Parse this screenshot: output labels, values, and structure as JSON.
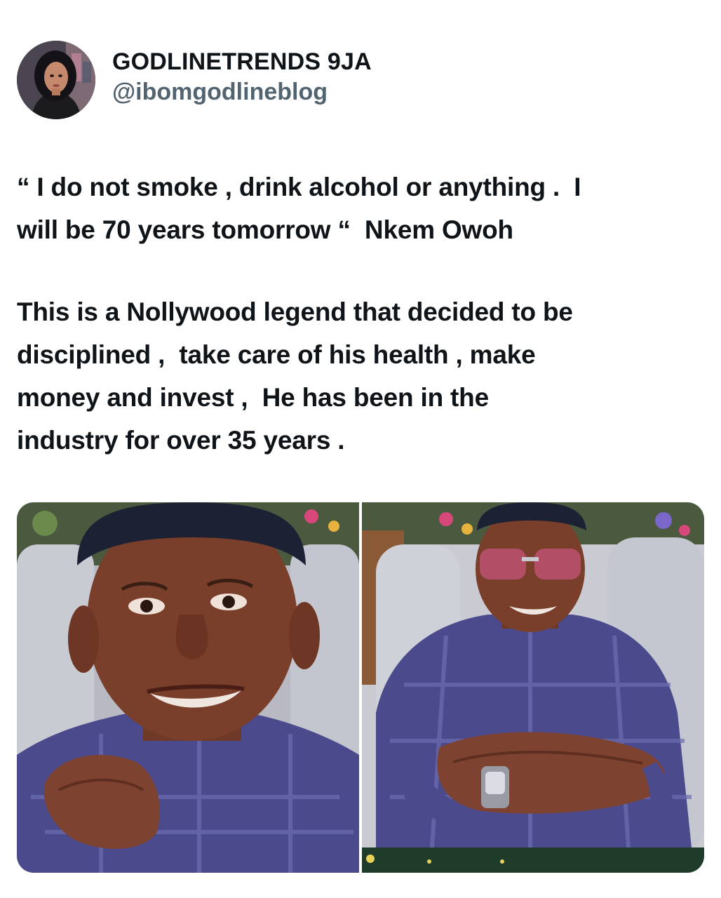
{
  "author": {
    "display_name": "GODLINETRENDS 9JA",
    "handle": "@ibomgodlineblog",
    "avatar_icon": "profile-avatar"
  },
  "tweet": {
    "paragraph_1": "“ I do not smoke , drink alcohol or anything .  I\nwill be 70 years tomorrow “  Nkem Owoh",
    "paragraph_2": "This is a Nollywood legend that decided to be\ndisciplined ,  take care of his health , make\nmoney and invest ,  He has been in the\nindustry for over 35 years ."
  },
  "media": {
    "count": 2,
    "colors": {
      "shirt": "#4a4a8c",
      "skin": "#7a3f2a",
      "cap": "#1c2233",
      "chair": "#c9cbd3"
    }
  }
}
